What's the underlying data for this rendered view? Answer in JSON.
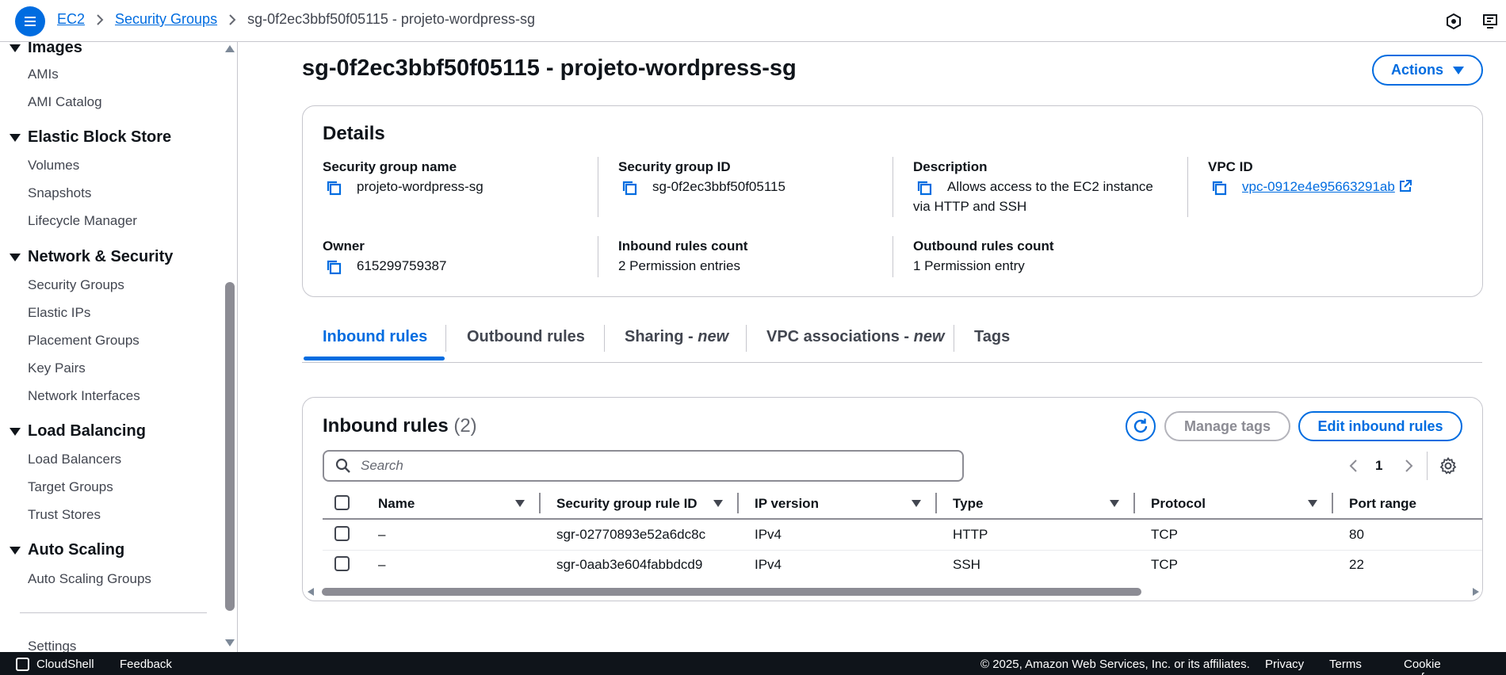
{
  "breadcrumb": {
    "service": "EC2",
    "section": "Security Groups",
    "current": "sg-0f2ec3bbf50f05115 - projeto-wordpress-sg"
  },
  "sidebar": {
    "sections": [
      {
        "title": "Images",
        "items": [
          "AMIs",
          "AMI Catalog"
        ]
      },
      {
        "title": "Elastic Block Store",
        "items": [
          "Volumes",
          "Snapshots",
          "Lifecycle Manager"
        ]
      },
      {
        "title": "Network & Security",
        "items": [
          "Security Groups",
          "Elastic IPs",
          "Placement Groups",
          "Key Pairs",
          "Network Interfaces"
        ]
      },
      {
        "title": "Load Balancing",
        "items": [
          "Load Balancers",
          "Target Groups",
          "Trust Stores"
        ]
      },
      {
        "title": "Auto Scaling",
        "items": [
          "Auto Scaling Groups"
        ]
      }
    ],
    "settings": "Settings"
  },
  "page": {
    "title": "sg-0f2ec3bbf50f05115 - projeto-wordpress-sg",
    "actions_label": "Actions"
  },
  "details": {
    "title": "Details",
    "sg_name_label": "Security group name",
    "sg_name": "projeto-wordpress-sg",
    "sg_id_label": "Security group ID",
    "sg_id": "sg-0f2ec3bbf50f05115",
    "description_label": "Description",
    "description_line1": "Allows access to the EC2 instance",
    "description_line2": "via HTTP and SSH",
    "vpc_label": "VPC ID",
    "vpc_id": "vpc-0912e4e95663291ab",
    "owner_label": "Owner",
    "owner": "615299759387",
    "inbound_count_label": "Inbound rules count",
    "inbound_count": "2 Permission entries",
    "outbound_count_label": "Outbound rules count",
    "outbound_count": "1 Permission entry"
  },
  "tabs": {
    "inbound": "Inbound rules",
    "outbound": "Outbound rules",
    "sharing": "Sharing - ",
    "sharing_new": "new",
    "vpc_assoc": "VPC associations - ",
    "vpc_assoc_new": "new",
    "tags": "Tags"
  },
  "inbound": {
    "title": "Inbound rules",
    "count": "(2)",
    "manage_tags": "Manage tags",
    "edit_rules": "Edit inbound rules",
    "search_placeholder": "Search",
    "page": "1",
    "columns": [
      "Name",
      "Security group rule ID",
      "IP version",
      "Type",
      "Protocol",
      "Port range"
    ],
    "rows": [
      {
        "name": "–",
        "rule_id": "sgr-02770893e52a6dc8c",
        "ip_version": "IPv4",
        "type": "HTTP",
        "protocol": "TCP",
        "port": "80"
      },
      {
        "name": "–",
        "rule_id": "sgr-0aab3e604fabbdcd9",
        "ip_version": "IPv4",
        "type": "SSH",
        "protocol": "TCP",
        "port": "22"
      }
    ]
  },
  "footer": {
    "cloudshell": "CloudShell",
    "feedback": "Feedback",
    "copyright": "© 2025, Amazon Web Services, Inc. or its affiliates.",
    "privacy": "Privacy",
    "terms": "Terms",
    "cookies": "Cookie preferences"
  },
  "colors": {
    "accent": "#006ce0",
    "footer_bg": "#0f141a"
  }
}
